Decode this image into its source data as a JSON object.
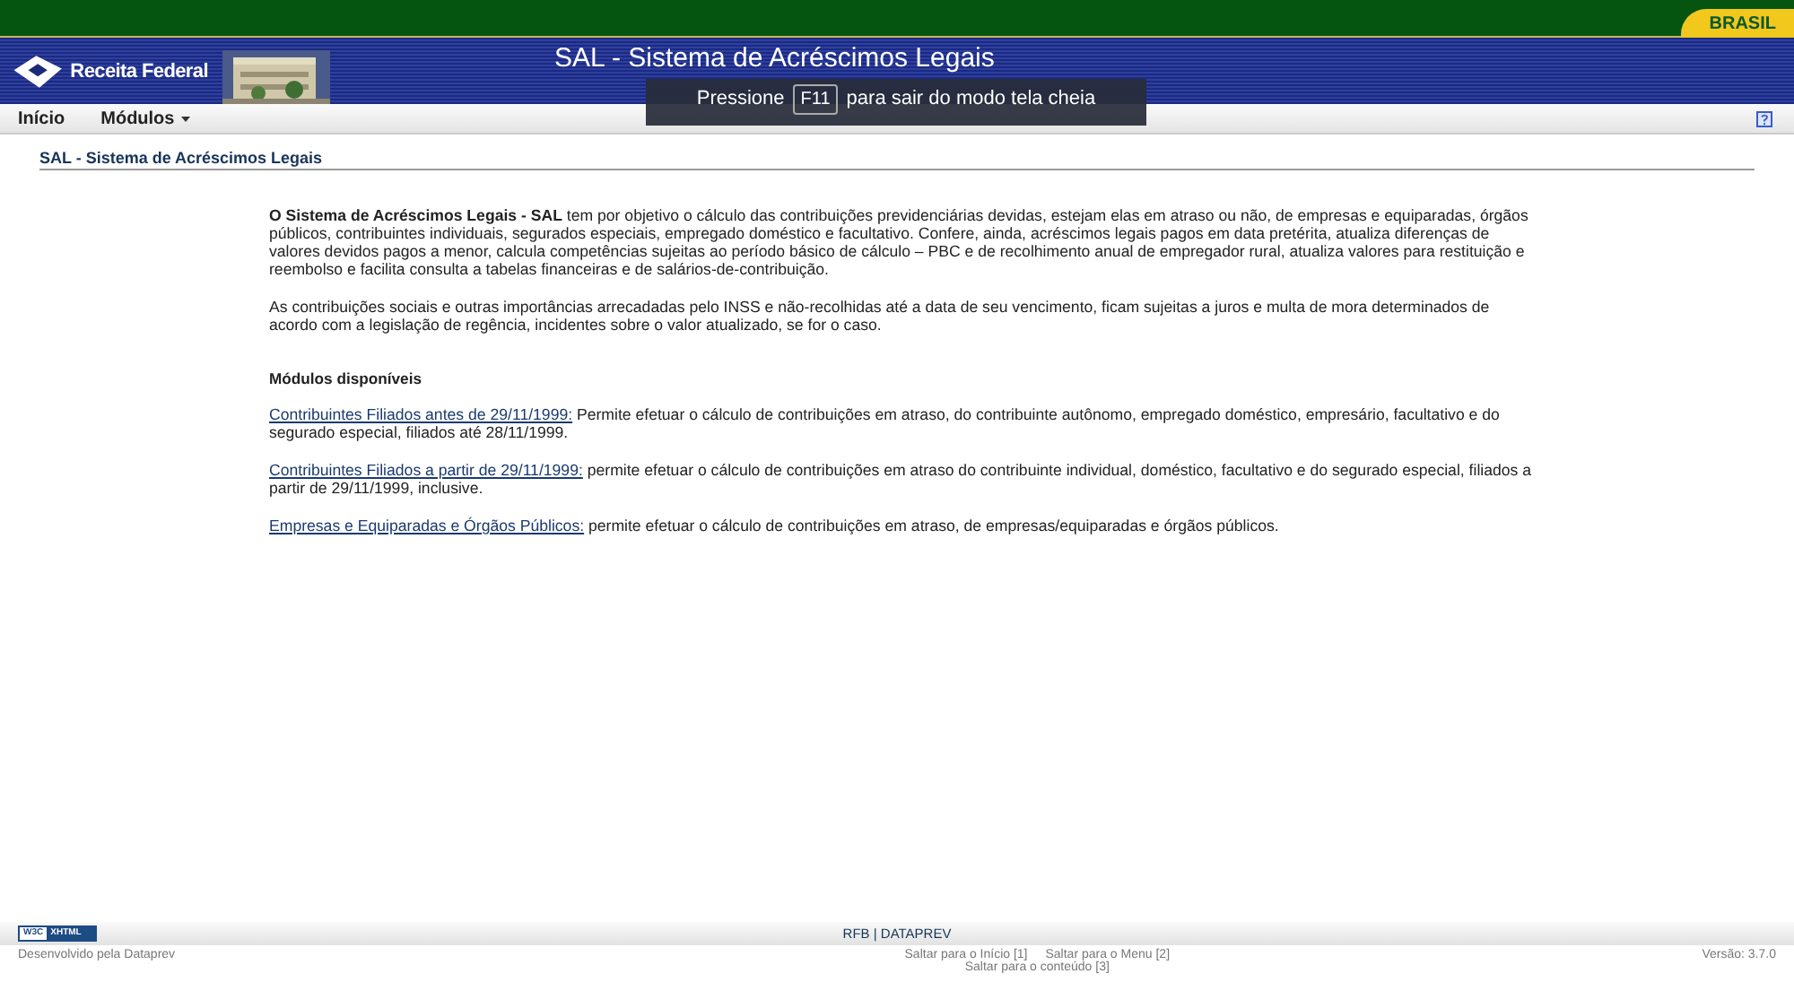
{
  "top_bar": {
    "badge": "BRASIL"
  },
  "banner": {
    "logo_text": "Receita Federal",
    "title": "SAL - Sistema de Acréscimos Legais"
  },
  "fullscreen_notice": {
    "before": "Pressione",
    "key": "F11",
    "after": "para sair do modo tela cheia"
  },
  "menu": [
    {
      "label": "Início",
      "has_dropdown": false
    },
    {
      "label": "Módulos",
      "has_dropdown": true
    }
  ],
  "page_heading": "SAL - Sistema de Acréscimos Legais",
  "intro": [
    "**O Sistema de Acréscimos Legais - SAL** tem por objetivo o cálculo das contribuições previdenciárias devidas, estejam elas em atraso ou não, de empresas e equiparadas, órgãos públicos, contribuintes individuais, segurados especiais, empregado doméstico e facultativo. Confere, ainda, acréscimos legais pagos em data pretérita, atualiza diferenças de valores devidos pagos a menor, calcula competências sujeitas ao período básico de cálculo – PBC e de recolhimento anual de empregador rural, atualiza valores para restituição e reembolso e facilita consulta a tabelas financeiras e de salários-de-contribuição.",
    "As contribuições sociais e outras importâncias arrecadadas pelo INSS e não-recolhidas até a data de seu vencimento, ficam sujeitas a juros e multa de mora determinados de acordo com a legislação de regência, incidentes sobre o valor atualizado, se for o caso."
  ],
  "modules_heading": "Módulos disponíveis",
  "modules": [
    {
      "link": "Contribuintes Filiados antes de 29/11/1999:",
      "text": " Permite efetuar o cálculo de contribuições em atraso, do contribuinte autônomo, empregado doméstico, empresário, facultativo e do segurado especial, filiados até 28/11/1999."
    },
    {
      "link": "Contribuintes Filiados a partir de 29/11/1999:",
      "text": " permite efetuar o cálculo de contribuições em atraso do contribuinte individual, doméstico, facultativo e do segurado especial, filiados a partir de 29/11/1999, inclusive."
    },
    {
      "link": "Empresas e Equiparadas e Órgãos Públicos:",
      "text": " permite efetuar o cálculo de contribuições em atraso, de empresas/equiparadas e órgãos públicos."
    }
  ],
  "footer": {
    "badge_left": "W3C",
    "badge_right": "XHTML",
    "center": "RFB | DATAPREV",
    "developer": "Desenvolvido pela Dataprev",
    "skip_links": [
      "Saltar para o Início [1]",
      "Saltar para o Menu [2]",
      "Saltar para o conteúdo [3]"
    ],
    "version": "Versão: 3.7.0"
  }
}
